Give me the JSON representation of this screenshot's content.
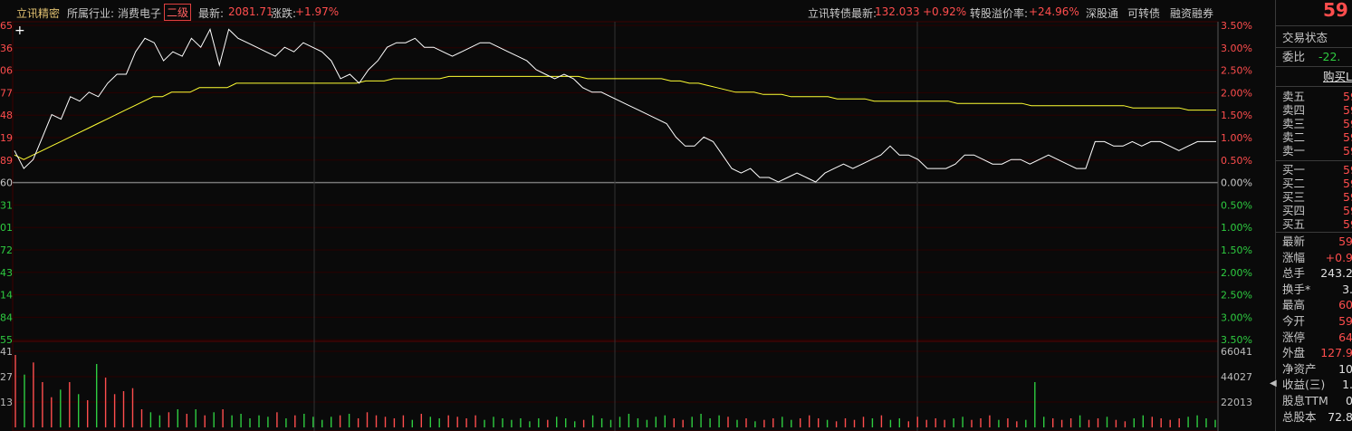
{
  "header": {
    "stock_name": "立讯精密",
    "industry_label": "所属行业:",
    "industry_name": "消费电子",
    "level_badge": "二级",
    "index_label": "最新:",
    "index_value": "2081.71",
    "change_label": "涨跌:",
    "change_value": "+1.97%",
    "bond_label": "立讯转债最新:",
    "bond_price": "132.033",
    "bond_change": "+0.92%",
    "premium_label": "转股溢价率:",
    "premium_value": "+24.96%",
    "link_hk": "深股通",
    "link_convertible": "可转债",
    "link_margin": "融资融券"
  },
  "colors": {
    "up": "#ff4d4d",
    "down": "#2ecc40",
    "price_line": "#ffffff",
    "avg_line": "#ffff33",
    "grid": "#3a0000",
    "accent": "#e0a020"
  },
  "left_axis_labels": [
    "65",
    "36",
    "06",
    "77",
    "48",
    "19",
    "89",
    "60",
    "31",
    "01",
    "72",
    "43",
    "14",
    "84",
    "55"
  ],
  "right_axis_labels": [
    "3.50%",
    "3.00%",
    "2.50%",
    "2.00%",
    "1.50%",
    "1.00%",
    "0.50%",
    "0.00%",
    "0.50%",
    "1.00%",
    "1.50%",
    "2.00%",
    "2.50%",
    "3.00%",
    "3.50%"
  ],
  "volume_left_labels": [
    "41",
    "27",
    "13"
  ],
  "volume_right_labels": [
    "66041",
    "44027",
    "22013"
  ],
  "chart_data": {
    "type": "line",
    "ylabel": "",
    "ylim": [
      -3.5,
      3.5
    ],
    "series": [
      {
        "values": [
          0.7,
          0.3,
          0.5,
          1.0,
          1.5,
          1.4,
          1.9,
          1.8,
          2.0,
          1.9,
          2.2,
          2.4,
          2.4,
          2.9,
          3.2,
          3.1,
          2.7,
          2.9,
          2.8,
          3.2,
          3.0,
          3.4,
          2.6,
          3.4,
          3.2,
          3.1,
          3.0,
          2.9,
          2.8,
          3.0,
          2.9,
          3.1,
          3.0,
          2.9,
          2.7,
          2.3,
          2.4,
          2.2,
          2.5,
          2.7,
          3.0,
          3.1,
          3.1,
          3.2,
          3.0,
          3.0,
          2.9,
          2.8,
          2.9,
          3.0,
          3.1,
          3.1,
          3.0,
          2.9,
          2.8,
          2.7,
          2.5,
          2.4,
          2.3,
          2.4,
          2.3,
          2.1,
          2.0,
          2.0,
          1.9,
          1.8,
          1.7,
          1.6,
          1.5,
          1.4,
          1.3,
          1.0,
          0.8,
          0.8,
          1.0,
          0.9,
          0.6,
          0.3,
          0.2,
          0.3,
          0.1,
          0.1,
          0.0,
          0.1,
          0.2,
          0.1,
          0.0,
          0.2,
          0.3,
          0.4,
          0.3,
          0.4,
          0.5,
          0.6,
          0.8,
          0.6,
          0.6,
          0.5,
          0.3,
          0.3,
          0.3,
          0.4,
          0.6,
          0.6,
          0.5,
          0.4,
          0.4,
          0.5,
          0.5,
          0.4,
          0.5,
          0.6,
          0.5,
          0.4,
          0.3,
          0.3,
          0.9,
          0.9,
          0.8,
          0.8,
          0.9,
          0.8,
          0.9,
          0.9,
          0.8,
          0.7,
          0.8,
          0.9,
          0.9,
          0.9
        ]
      },
      {
        "values": [
          0.6,
          0.5,
          0.6,
          0.7,
          0.8,
          0.9,
          1.0,
          1.1,
          1.2,
          1.3,
          1.4,
          1.5,
          1.6,
          1.7,
          1.8,
          1.9,
          1.9,
          2.0,
          2.0,
          2.0,
          2.1,
          2.1,
          2.1,
          2.1,
          2.2,
          2.2,
          2.2,
          2.2,
          2.2,
          2.2,
          2.2,
          2.2,
          2.2,
          2.2,
          2.2,
          2.2,
          2.2,
          2.2,
          2.25,
          2.25,
          2.25,
          2.3,
          2.3,
          2.3,
          2.3,
          2.3,
          2.3,
          2.35,
          2.35,
          2.35,
          2.35,
          2.35,
          2.35,
          2.35,
          2.35,
          2.35,
          2.35,
          2.35,
          2.35,
          2.35,
          2.35,
          2.35,
          2.3,
          2.3,
          2.3,
          2.3,
          2.3,
          2.3,
          2.3,
          2.3,
          2.3,
          2.25,
          2.25,
          2.2,
          2.2,
          2.15,
          2.1,
          2.05,
          2.0,
          2.0,
          2.0,
          1.95,
          1.95,
          1.95,
          1.9,
          1.9,
          1.9,
          1.9,
          1.9,
          1.85,
          1.85,
          1.85,
          1.85,
          1.8,
          1.8,
          1.8,
          1.8,
          1.8,
          1.8,
          1.8,
          1.8,
          1.8,
          1.75,
          1.75,
          1.75,
          1.75,
          1.75,
          1.75,
          1.75,
          1.75,
          1.7,
          1.7,
          1.7,
          1.7,
          1.7,
          1.7,
          1.7,
          1.7,
          1.7,
          1.7,
          1.7,
          1.65,
          1.65,
          1.65,
          1.65,
          1.65,
          1.65,
          1.6,
          1.6,
          1.6,
          1.6
        ]
      }
    ],
    "volume": [
      48,
      35,
      43,
      30,
      20,
      25,
      30,
      22,
      18,
      42,
      33,
      22,
      24,
      26,
      12,
      10,
      8,
      10,
      12,
      9,
      12,
      8,
      10,
      12,
      8,
      9,
      6,
      8,
      7,
      10,
      6,
      8,
      9,
      7,
      5,
      7,
      8,
      9,
      6,
      10,
      8,
      7,
      6,
      8,
      5,
      9,
      7,
      6,
      8,
      7,
      6,
      8,
      5,
      7,
      6,
      5,
      6,
      4,
      6,
      5,
      7,
      6,
      4,
      5,
      8,
      6,
      5,
      7,
      9,
      6,
      5,
      7,
      8,
      6,
      5,
      7,
      9,
      6,
      8,
      7,
      5,
      6,
      4,
      5,
      6,
      7,
      5,
      6,
      8,
      6,
      5,
      4,
      6,
      5,
      7,
      6,
      8,
      5,
      6,
      4,
      7,
      5,
      6,
      5,
      6,
      7,
      5,
      6,
      8,
      5,
      6,
      4,
      5,
      30,
      7,
      6,
      5,
      6,
      8,
      5,
      6,
      7,
      5,
      4,
      6,
      8,
      7,
      6,
      5,
      6,
      7,
      8,
      6,
      5
    ],
    "volume_ylim": [
      0,
      66041
    ]
  },
  "sidebar": {
    "price_top": "59",
    "status_label": "交易状态",
    "ratio_label": "委比",
    "ratio_value": "-22.",
    "buy_button": "购买L",
    "asks": [
      "卖五",
      "卖四",
      "卖三",
      "卖二",
      "卖一"
    ],
    "bids": [
      "买一",
      "买二",
      "买三",
      "买四",
      "买五"
    ],
    "quote_value": "59",
    "stats": [
      {
        "label": "最新",
        "value": "59"
      },
      {
        "label": "涨幅",
        "value": "+0.9"
      },
      {
        "label": "总手",
        "value": "243.2"
      },
      {
        "label": "换手*",
        "value": "3."
      },
      {
        "label": "最高",
        "value": "60"
      },
      {
        "label": "今开",
        "value": "59"
      },
      {
        "label": "涨停",
        "value": "64"
      },
      {
        "label": "外盘",
        "value": "127.9"
      },
      {
        "label": "净资产",
        "value": "10"
      },
      {
        "label": "收益(三)",
        "value": "1."
      },
      {
        "label": "股息TTM",
        "value": "0"
      },
      {
        "label": "总股本",
        "value": "72.8"
      }
    ]
  }
}
